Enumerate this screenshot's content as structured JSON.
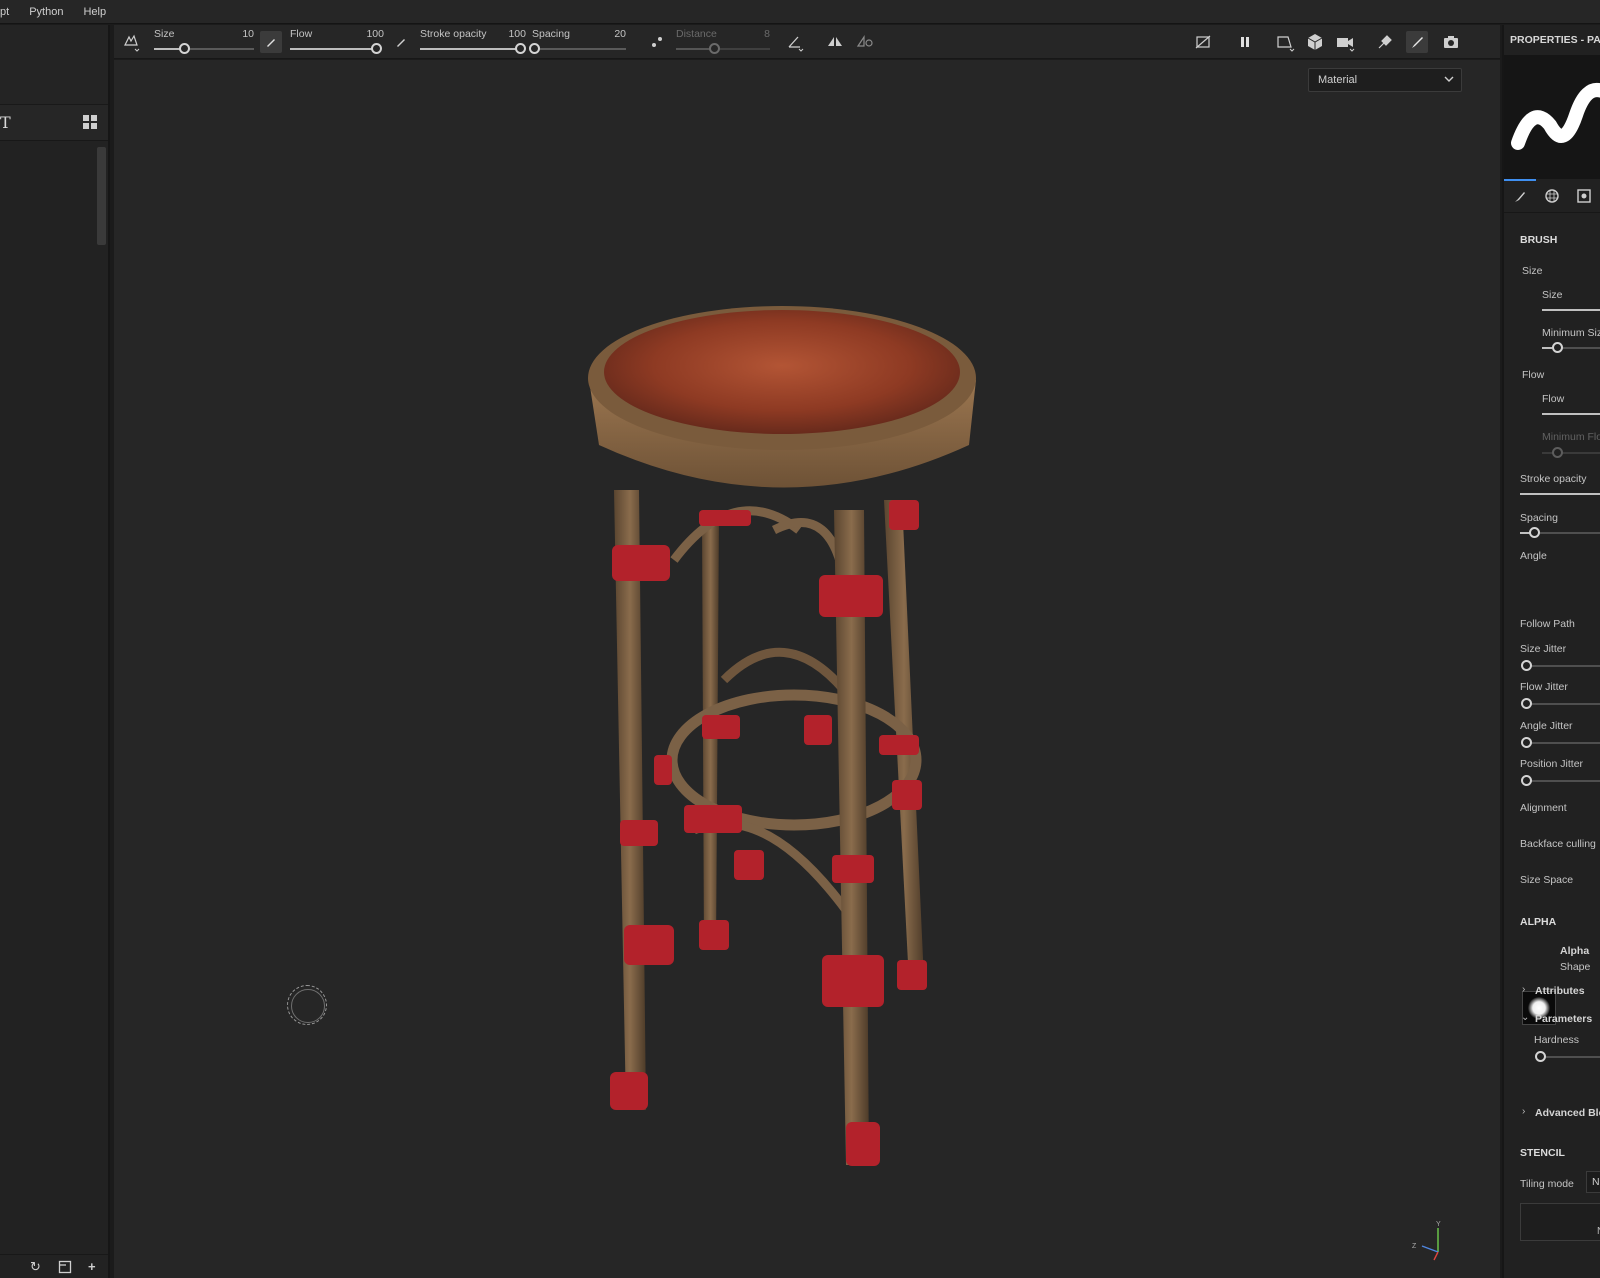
{
  "menu": [
    "pt",
    "Python",
    "Help"
  ],
  "toolbar": {
    "size": {
      "label": "Size",
      "value": "10",
      "fraction": 0.3
    },
    "flow": {
      "label": "Flow",
      "value": "100",
      "fraction": 1.0
    },
    "stroke_opacity": {
      "label": "Stroke opacity",
      "value": "100",
      "fraction": 1.0
    },
    "spacing": {
      "label": "Spacing",
      "value": "20",
      "fraction": 0.02
    },
    "distance": {
      "label": "Distance",
      "value": "8",
      "fraction": 0.4
    }
  },
  "viewport": {
    "mode_select": "Material"
  },
  "left_panel": {
    "tab_letter": "T"
  },
  "properties": {
    "title": "PROPERTIES - PAIN",
    "brush_section": "BRUSH",
    "size_group": "Size",
    "size": "Size",
    "minimum_size": "Minimum Siz",
    "flow_group": "Flow",
    "flow": "Flow",
    "minimum_flow": "Minimum Flo",
    "stroke_opacity": "Stroke opacity",
    "spacing": "Spacing",
    "angle": "Angle",
    "follow_path": "Follow Path",
    "size_jitter": "Size Jitter",
    "flow_jitter": "Flow Jitter",
    "angle_jitter": "Angle Jitter",
    "position_jitter": "Position Jitter",
    "alignment": "Alignment",
    "backface_culling": "Backface culling",
    "size_space": "Size Space",
    "alpha_section": "ALPHA",
    "alpha_name": "Alpha",
    "alpha_type": "Shape",
    "attributes": "Attributes",
    "parameters": "Parameters",
    "hardness": "Hardness",
    "advanced": "Advanced Ble",
    "stencil_section": "STENCIL",
    "tiling_mode": "Tiling mode",
    "tiling_value": "No",
    "stencil_button": "N"
  },
  "gizmo": {
    "x": "Z",
    "y": "Y"
  },
  "colors": {
    "accent": "#3f8ff0",
    "panel": "#212121",
    "viewport": "#262626"
  }
}
